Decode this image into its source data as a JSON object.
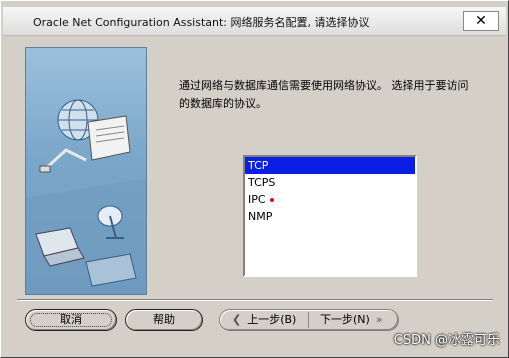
{
  "window": {
    "title": "Oracle Net Configuration Assistant: 网络服务名配置, 请选择协议",
    "close_label": "✕"
  },
  "instruction": "通过网络与数据库通信需要使用网络协议。 选择用于要访问的数据库的协议。",
  "protocols": {
    "items": [
      {
        "label": "TCP",
        "selected": true
      },
      {
        "label": "TCPS",
        "selected": false
      },
      {
        "label": "IPC",
        "selected": false
      },
      {
        "label": "NMP",
        "selected": false
      }
    ]
  },
  "buttons": {
    "cancel": "取消",
    "help": "帮助",
    "back": "上一步(B)",
    "next": "下一步(N)"
  },
  "watermark": "CSDN @冰露可乐",
  "colors": {
    "selection": "#0a1ee6",
    "dialog_bg": "#d4d0c8"
  }
}
